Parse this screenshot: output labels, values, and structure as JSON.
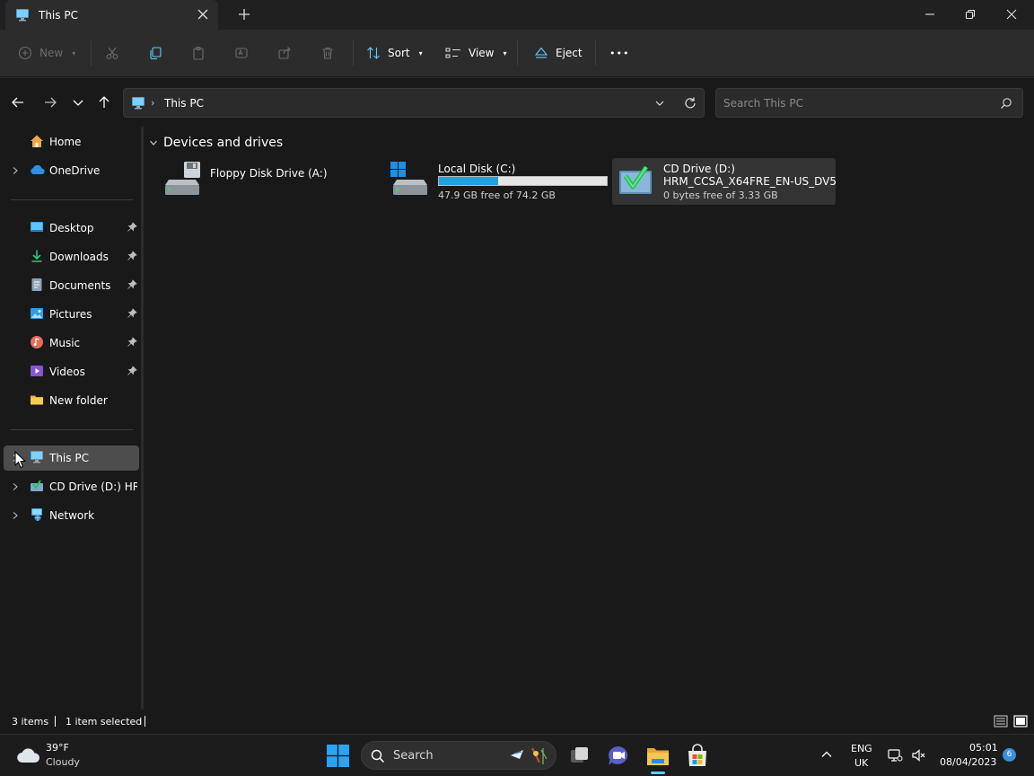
{
  "window": {
    "tab_title": "This PC",
    "new_tab_label": "+"
  },
  "commands": {
    "new": "New",
    "sort": "Sort",
    "view": "View",
    "eject": "Eject",
    "more": "•••"
  },
  "address": {
    "path": "This PC",
    "search_placeholder": "Search This PC"
  },
  "sidebar": {
    "home": "Home",
    "onedrive": "OneDrive",
    "pinned": [
      "Desktop",
      "Downloads",
      "Documents",
      "Pictures",
      "Music",
      "Videos",
      "New folder"
    ],
    "this_pc": "This PC",
    "cd_drive": "CD Drive (D:) HRM_",
    "network": "Network"
  },
  "content": {
    "group_title": "Devices and drives",
    "drives": [
      {
        "name": "Floppy Disk Drive (A:)"
      },
      {
        "name": "Local Disk (C:)",
        "free": "47.9 GB free of 74.2 GB",
        "used_fraction": 0.355
      },
      {
        "name": "CD Drive (D:)",
        "label": "HRM_CCSA_X64FRE_EN-US_DV5",
        "free": "0 bytes free of 3.33 GB"
      }
    ]
  },
  "status": {
    "items": "3 items",
    "selected": "1 item selected"
  },
  "taskbar": {
    "temp": "39°F",
    "condition": "Cloudy",
    "search_label": "Search",
    "lang_line1": "ENG",
    "lang_line2": "UK",
    "time": "05:01",
    "date": "08/04/2023",
    "notifications": "6"
  },
  "colors": {
    "accent": "#60cdff",
    "progress": "#26a0da",
    "selection": "#4d4d4d"
  }
}
